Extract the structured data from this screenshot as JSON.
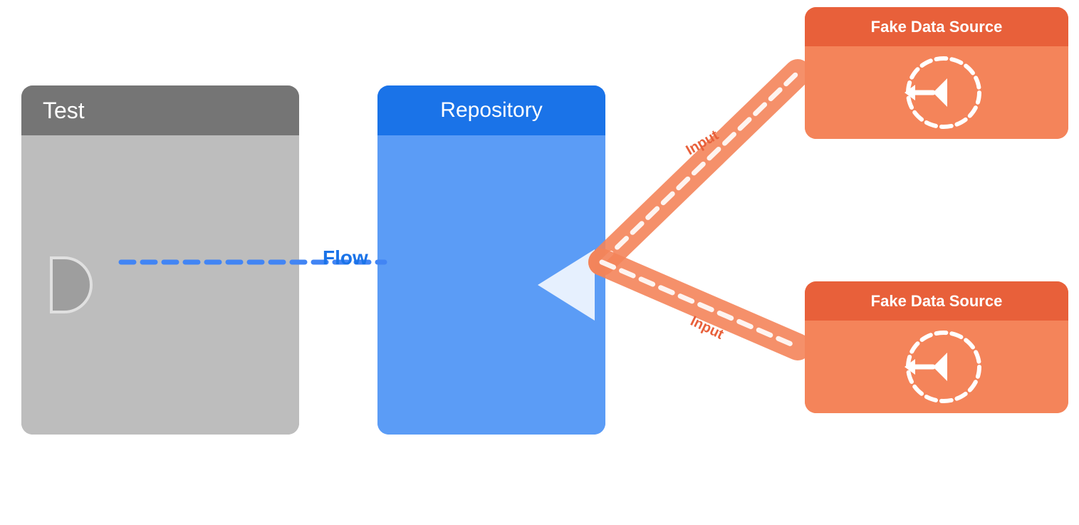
{
  "test_block": {
    "header": "Test"
  },
  "repo_block": {
    "header": "Repository"
  },
  "fake_source_top": {
    "header": "Fake Data Source",
    "input_label": "Input"
  },
  "fake_source_bottom": {
    "header": "Fake Data Source",
    "input_label": "Input"
  },
  "flow_label": "Flow",
  "colors": {
    "blue_dark": "#1a73e8",
    "blue_light": "#4285f4",
    "orange_dark": "#e8603a",
    "orange_light": "#f4845a",
    "grey_dark": "#757575",
    "grey_light": "#bdbdbd"
  }
}
